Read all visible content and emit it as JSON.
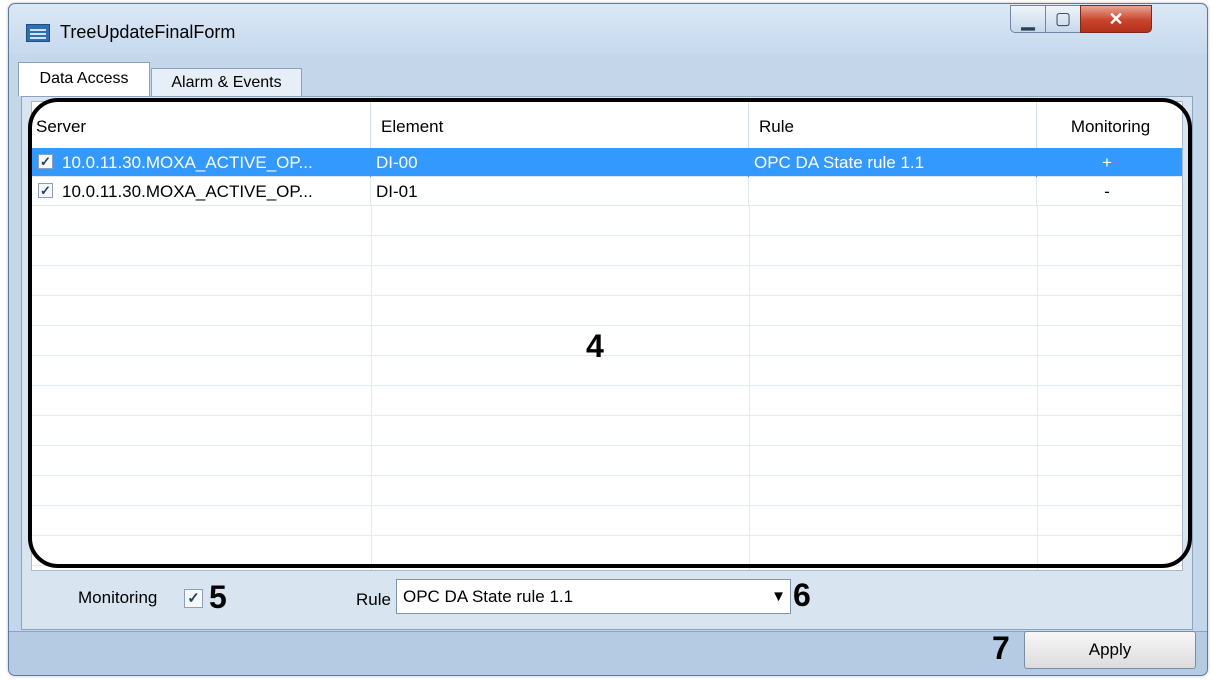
{
  "window": {
    "title": "TreeUpdateFinalForm",
    "controls": {
      "minimize": "▁",
      "maximize": "▢",
      "close": "✕"
    }
  },
  "tabs": [
    {
      "label": "Data Access",
      "active": true
    },
    {
      "label": "Alarm & Events",
      "active": false
    }
  ],
  "grid": {
    "columns": [
      "Server",
      "Element",
      "Rule",
      "Monitoring"
    ],
    "rows": [
      {
        "checked": true,
        "server": "10.0.11.30.MOXA_ACTIVE_OP...",
        "element": "DI-00",
        "rule": "OPC DA State rule 1.1",
        "monitoring": "+",
        "selected": true
      },
      {
        "checked": true,
        "server": "10.0.11.30.MOXA_ACTIVE_OP...",
        "element": "DI-01",
        "rule": "",
        "monitoring": "-",
        "selected": false
      }
    ]
  },
  "controls": {
    "monitoring_label": "Monitoring",
    "monitoring_checked": true,
    "rule_label": "Rule",
    "rule_value": "OPC DA State rule 1.1",
    "apply_label": "Apply"
  },
  "callouts": {
    "grid": "4",
    "monitoring": "5",
    "rule": "6",
    "apply": "7"
  },
  "checkmark": "✓",
  "colors": {
    "selection": "#3399ff",
    "window_frame": "#c3d6ea",
    "close_button": "#c9432a"
  }
}
